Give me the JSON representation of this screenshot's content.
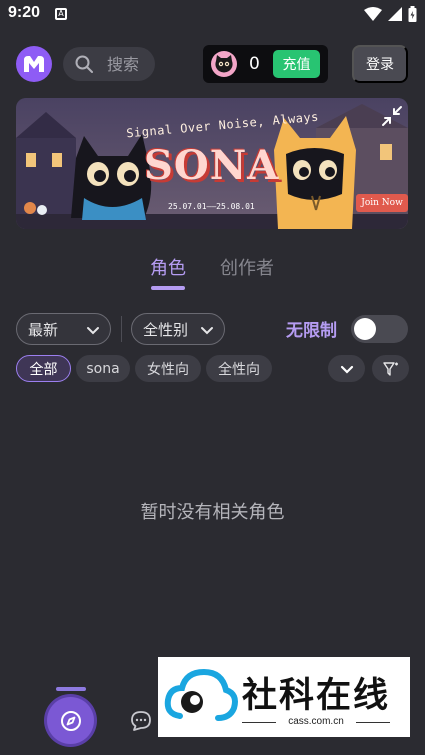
{
  "status_bar": {
    "time": "9:20",
    "sim_icon": "sim-card-icon",
    "icons": [
      "wifi-icon",
      "signal-icon",
      "battery-icon"
    ]
  },
  "header": {
    "logo": "M",
    "search_placeholder": "搜索",
    "coin_count": "0",
    "recharge_label": "充值",
    "login_label": "登录"
  },
  "banner": {
    "tagline": "Signal Over Noise, Always",
    "title": "SONA",
    "dates": "25.07.01——25.08.01",
    "cta": "Join Now"
  },
  "tabs": {
    "characters": "角色",
    "creators": "创作者",
    "active": "characters"
  },
  "filters": {
    "sort": "最新",
    "gender": "全性别",
    "unlimited_label": "无限制",
    "unlimited_on": false
  },
  "chips": [
    {
      "label": "全部",
      "active": true
    },
    {
      "label": "sona",
      "active": false
    },
    {
      "label": "女性向",
      "active": false
    },
    {
      "label": "全性向",
      "active": false
    }
  ],
  "empty_message": "暂时没有相关角色",
  "watermark": {
    "title": "社科在线",
    "subtitle": "cass.com.cn"
  },
  "colors": {
    "accent": "#b59cf2",
    "recharge": "#28c472",
    "background": "#2b2b31"
  }
}
